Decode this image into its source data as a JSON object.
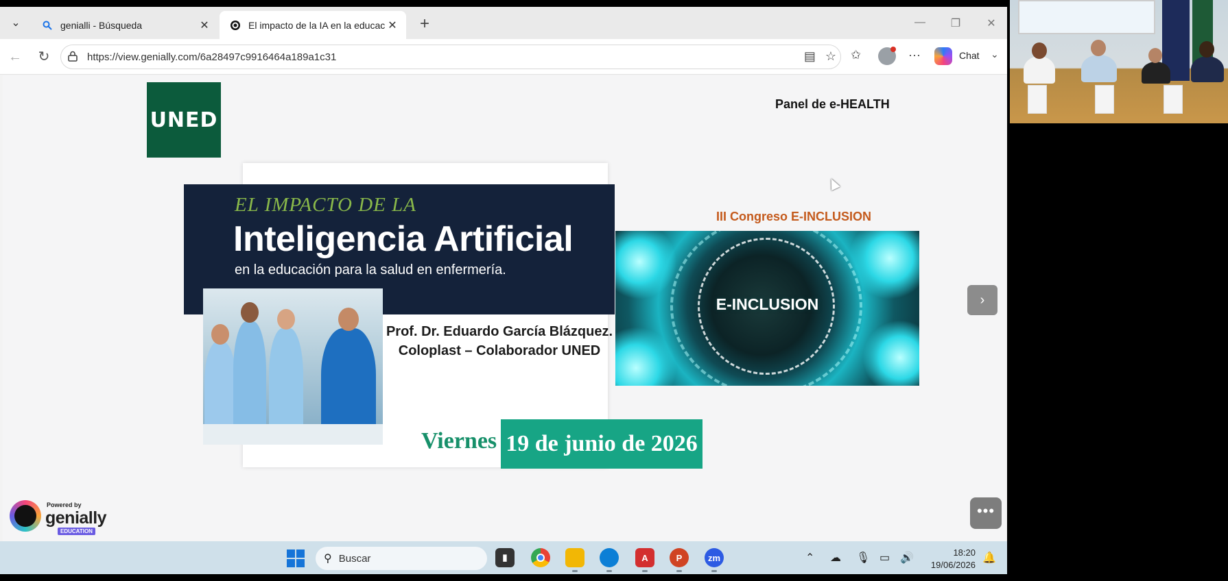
{
  "browser": {
    "tabs": [
      {
        "title": "genialli - Búsqueda",
        "close": "✕"
      },
      {
        "title": "El impacto de la IA en la educación",
        "close": "✕"
      }
    ],
    "new_tab": "+",
    "url": "https://view.genially.com/6a28497c9916464a189a1c31",
    "chat_label": "Chat"
  },
  "slide": {
    "logo_text": "UNED",
    "panel_title": "Panel de e-HEALTH",
    "kicker": "EL IMPACTO DE LA",
    "title": "Inteligencia Artificial",
    "subtitle": "en la educación para la salud en enfermería.",
    "prof_line1": "Prof. Dr. Eduardo García Blázquez.",
    "prof_line2": "Coloplast – Colaborador UNED",
    "day": "Viernes",
    "date": "19 de junio de 2026",
    "congreso": "III Congreso E-INCLUSION",
    "einclusion_label": "E-INCLUSION"
  },
  "genially": {
    "powered": "Powered by",
    "name": "genially",
    "edition": "EDUCATION"
  },
  "taskbar": {
    "search_label": "Buscar",
    "time": "18:20",
    "date": "19/06/2026"
  },
  "colors": {
    "uned_green": "#0c5b3c",
    "banner_navy": "#14223a",
    "date_teal": "#17a585",
    "congreso_orange": "#c45a1c"
  }
}
